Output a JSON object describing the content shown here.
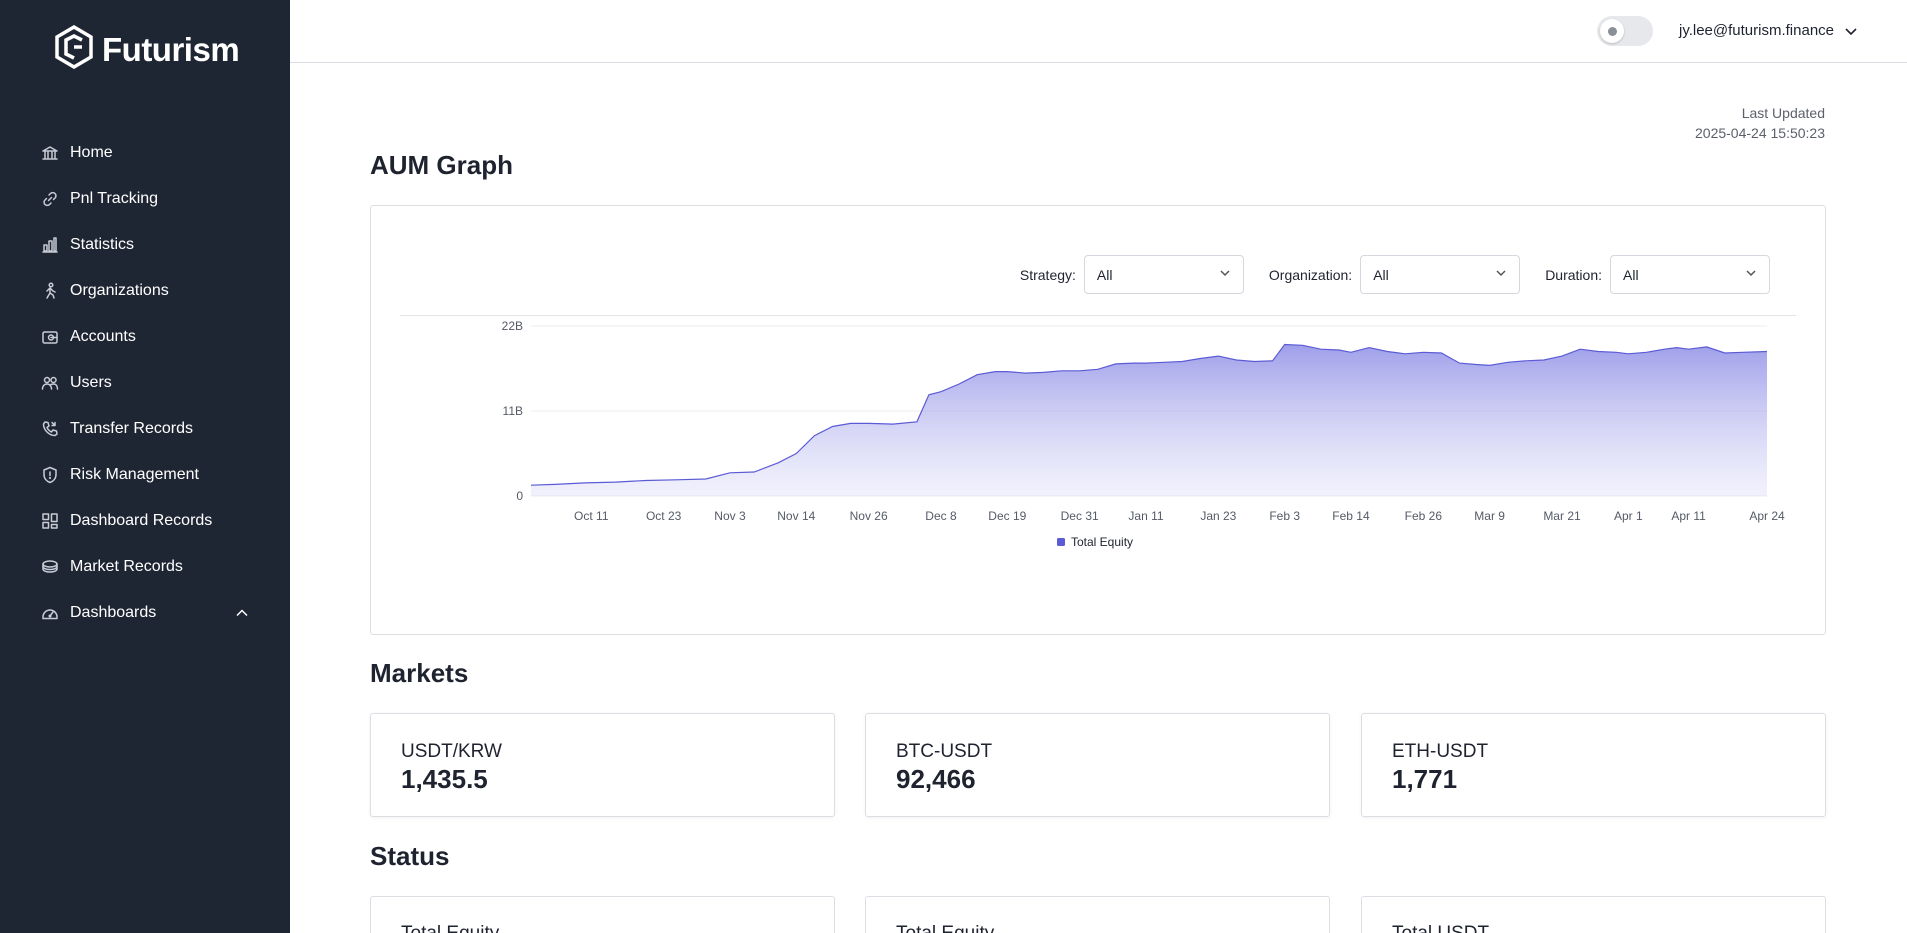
{
  "brand": {
    "name": "Futurism"
  },
  "sidebar": {
    "items": [
      {
        "label": "Home",
        "icon": "bank-icon"
      },
      {
        "label": "Pnl Tracking",
        "icon": "link-icon"
      },
      {
        "label": "Statistics",
        "icon": "bar-chart-icon"
      },
      {
        "label": "Organizations",
        "icon": "person-walking-icon"
      },
      {
        "label": "Accounts",
        "icon": "wallet-icon"
      },
      {
        "label": "Users",
        "icon": "users-icon"
      },
      {
        "label": "Transfer Records",
        "icon": "phone-icon"
      },
      {
        "label": "Risk Management",
        "icon": "shield-icon"
      },
      {
        "label": "Dashboard Records",
        "icon": "grid-icon"
      },
      {
        "label": "Market Records",
        "icon": "coins-icon"
      },
      {
        "label": "Dashboards",
        "icon": "gauge-icon",
        "expanded": true
      }
    ]
  },
  "header": {
    "user_email": "jy.lee@futurism.finance",
    "theme_toggle": "light"
  },
  "last_updated": {
    "label": "Last Updated",
    "value": "2025-04-24 15:50:23"
  },
  "aum": {
    "title": "AUM Graph",
    "filters": {
      "strategy": {
        "label": "Strategy:",
        "value": "All"
      },
      "organization": {
        "label": "Organization:",
        "value": "All"
      },
      "duration": {
        "label": "Duration:",
        "value": "All"
      }
    }
  },
  "chart_data": {
    "type": "area",
    "y_ticks": [
      "0",
      "11B",
      "22B"
    ],
    "ylim": [
      0,
      22
    ],
    "y_unit": "B",
    "x_ticks": [
      "Oct 11",
      "Oct 23",
      "Nov 3",
      "Nov 14",
      "Nov 26",
      "Dec 8",
      "Dec 19",
      "Dec 31",
      "Jan 11",
      "Jan 23",
      "Feb 3",
      "Feb 14",
      "Feb 26",
      "Mar 9",
      "Mar 21",
      "Apr 1",
      "Apr 11",
      "Apr 24"
    ],
    "x_start": "Oct 1",
    "legend_position": "bottom",
    "color": "#5b5bd6",
    "series": [
      {
        "name": "Total Equity",
        "x": [
          "Oct 1",
          "Oct 5",
          "Oct 10",
          "Oct 15",
          "Oct 20",
          "Oct 25",
          "Oct 30",
          "Nov 3",
          "Nov 7",
          "Nov 11",
          "Nov 14",
          "Nov 17",
          "Nov 20",
          "Nov 23",
          "Nov 26",
          "Nov 30",
          "Dec 4",
          "Dec 6",
          "Dec 8",
          "Dec 11",
          "Dec 14",
          "Dec 17",
          "Dec 19",
          "Dec 22",
          "Dec 25",
          "Dec 28",
          "Dec 31",
          "Jan 3",
          "Jan 6",
          "Jan 9",
          "Jan 11",
          "Jan 14",
          "Jan 17",
          "Jan 20",
          "Jan 23",
          "Jan 26",
          "Jan 29",
          "Feb 1",
          "Feb 3",
          "Feb 6",
          "Feb 9",
          "Feb 12",
          "Feb 14",
          "Feb 17",
          "Feb 20",
          "Feb 23",
          "Feb 26",
          "Mar 1",
          "Mar 4",
          "Mar 7",
          "Mar 9",
          "Mar 12",
          "Mar 15",
          "Mar 18",
          "Mar 21",
          "Mar 24",
          "Mar 27",
          "Mar 30",
          "Apr 1",
          "Apr 4",
          "Apr 7",
          "Apr 9",
          "Apr 11",
          "Apr 14",
          "Apr 17",
          "Apr 20",
          "Apr 24"
        ],
        "values": [
          1.4,
          1.5,
          1.7,
          1.8,
          2.0,
          2.1,
          2.2,
          3.0,
          3.1,
          4.3,
          5.5,
          7.8,
          9.0,
          9.4,
          9.4,
          9.3,
          9.6,
          13.1,
          13.5,
          14.5,
          15.7,
          16.1,
          16.1,
          15.9,
          16.0,
          16.2,
          16.2,
          16.4,
          17.1,
          17.2,
          17.2,
          17.3,
          17.4,
          17.8,
          18.1,
          17.6,
          17.4,
          17.5,
          19.6,
          19.5,
          19.0,
          18.9,
          18.6,
          19.2,
          18.7,
          18.4,
          18.6,
          18.5,
          17.2,
          17.0,
          16.9,
          17.3,
          17.5,
          17.6,
          18.1,
          19.0,
          18.7,
          18.6,
          18.4,
          18.6,
          19.0,
          19.2,
          19.0,
          19.3,
          18.5,
          18.6,
          18.7
        ]
      }
    ]
  },
  "markets": {
    "title": "Markets",
    "items": [
      {
        "name": "USDT/KRW",
        "value": "1,435.5"
      },
      {
        "name": "BTC-USDT",
        "value": "92,466"
      },
      {
        "name": "ETH-USDT",
        "value": "1,771"
      }
    ]
  },
  "status": {
    "title": "Status",
    "items": [
      {
        "name": "Total Equity"
      },
      {
        "name": "Total Equity"
      },
      {
        "name": "Total USDT"
      }
    ]
  }
}
